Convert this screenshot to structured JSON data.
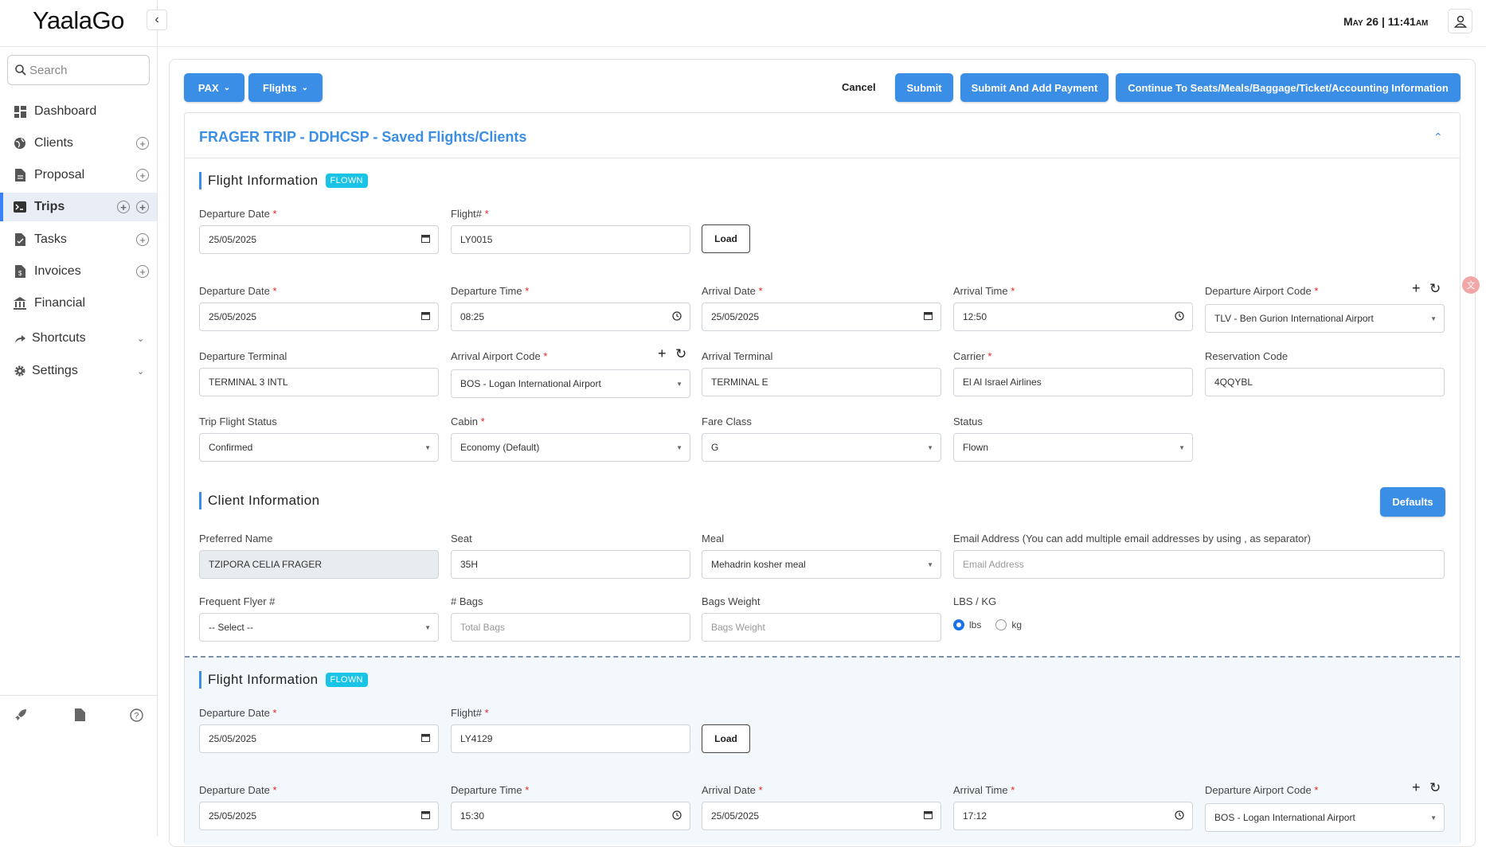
{
  "app": {
    "logo": "YaalaGo",
    "clock": "May 26 | 11:41am"
  },
  "sidebar": {
    "search_placeholder": "Search",
    "items": [
      {
        "label": "Dashboard",
        "icon": "dashboard-icon"
      },
      {
        "label": "Clients",
        "icon": "globe-icon"
      },
      {
        "label": "Proposal",
        "icon": "document-icon"
      },
      {
        "label": "Trips",
        "icon": "terminal-icon"
      },
      {
        "label": "Tasks",
        "icon": "task-icon"
      },
      {
        "label": "Invoices",
        "icon": "invoice-icon"
      },
      {
        "label": "Financial",
        "icon": "bank-icon"
      },
      {
        "label": "Shortcuts",
        "icon": "share-icon"
      },
      {
        "label": "Settings",
        "icon": "gear-icon"
      }
    ]
  },
  "toolbar": {
    "pax": "PAX",
    "flights": "Flights",
    "cancel": "Cancel",
    "submit": "Submit",
    "submit_payment": "Submit And Add Payment",
    "continue": "Continue To Seats/Meals/Baggage/Ticket/Accounting Information"
  },
  "panel": {
    "title": "FRAGER TRIP - DDHCSP - Saved Flights/Clients"
  },
  "labels": {
    "flight_info": "Flight Information",
    "flown": "FLOWN",
    "departure_date": "Departure Date",
    "flight_no": "Flight#",
    "load": "Load",
    "departure_time": "Departure Time",
    "arrival_date": "Arrival Date",
    "arrival_time": "Arrival Time",
    "departure_airport": "Departure Airport Code",
    "departure_terminal": "Departure Terminal",
    "arrival_airport": "Arrival Airport Code",
    "arrival_terminal": "Arrival Terminal",
    "carrier": "Carrier",
    "reservation_code": "Reservation Code",
    "trip_flight_status": "Trip Flight Status",
    "cabin": "Cabin",
    "fare_class": "Fare Class",
    "status": "Status",
    "client_info": "Client Information",
    "defaults": "Defaults",
    "preferred_name": "Preferred Name",
    "seat": "Seat",
    "meal": "Meal",
    "email": "Email Address (You can add multiple email addresses by using , as separator)",
    "ff": "Frequent Flyer #",
    "bags": "# Bags",
    "bags_weight": "Bags Weight",
    "lbs_kg": "LBS / KG",
    "lbs": "lbs",
    "kg": "kg",
    "req": "*"
  },
  "flight1": {
    "search_date": "25/05/2025",
    "flight_no": "LY0015",
    "dep_date": "25/05/2025",
    "dep_time": "08:25",
    "arr_date": "25/05/2025",
    "arr_time": "12:50",
    "dep_airport": "TLV - Ben Gurion International Airport",
    "dep_terminal": "TERMINAL 3 INTL",
    "arr_airport": "BOS - Logan International Airport",
    "arr_terminal": "TERMINAL E",
    "carrier": "El Al Israel Airlines",
    "reservation": "4QQYBL",
    "trip_status": "Confirmed",
    "cabin": "Economy (Default)",
    "fare_class": "G",
    "status": "Flown"
  },
  "client": {
    "preferred_name": "TZIPORA CELIA FRAGER",
    "seat": "35H",
    "meal": "Mehadrin kosher meal",
    "email_placeholder": "Email Address",
    "ff": "-- Select --",
    "bags_placeholder": "Total Bags",
    "weight_placeholder": "Bags Weight",
    "unit_selected": "lbs"
  },
  "flight2": {
    "search_date": "25/05/2025",
    "flight_no": "LY4129",
    "dep_date": "25/05/2025",
    "dep_time": "15:30",
    "arr_date": "25/05/2025",
    "arr_time": "17:12",
    "dep_airport": "BOS - Logan International Airport"
  }
}
